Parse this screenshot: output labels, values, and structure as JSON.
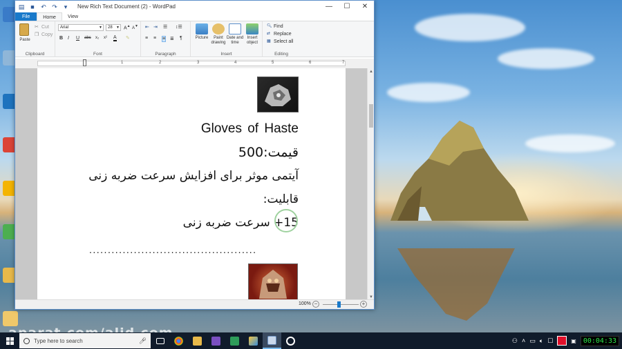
{
  "window": {
    "title": "New Rich Text Document (2) - WordPad",
    "controls": {
      "minimize": "—",
      "maximize": "☐",
      "close": "✕"
    }
  },
  "ribbon_tabs": [
    {
      "label": "File"
    },
    {
      "label": "Home"
    },
    {
      "label": "View"
    }
  ],
  "clipboard": {
    "paste": "Paste",
    "cut": "Cut",
    "copy": "Copy",
    "group": "Clipboard"
  },
  "font": {
    "family": "Arial",
    "size": "28",
    "group": "Font"
  },
  "paragraph": {
    "group": "Paragraph"
  },
  "insert": {
    "picture": "Picture",
    "paint_drawing": "Paint drawing",
    "date_time": "Date and time",
    "insert_object": "Insert object",
    "group": "Insert"
  },
  "editing": {
    "find": "Find",
    "replace": "Replace",
    "select_all": "Select all",
    "group": "Editing"
  },
  "ruler": {
    "numbers": [
      "1",
      "2",
      "3",
      "4",
      "5",
      "6",
      "7"
    ]
  },
  "document": {
    "title": "Gloves of Haste",
    "price": "قیمت:500",
    "description": "آیتمی موثر برای افزایش سرعت ضربه زنی",
    "ability_label": "قابلیت:",
    "ability_value": "15+ سرعت ضربه زنی",
    "separator": "............................................."
  },
  "statusbar": {
    "zoom": "100%",
    "zoom_level": 1.0
  },
  "watermark": "aparat.com/alid.com",
  "taskbar": {
    "search_placeholder": "Type here to search",
    "clock": "00:04:33"
  },
  "colors": {
    "accent": "#1979ca",
    "taskbar_bg": "#101b2b",
    "record": "#e0102a"
  }
}
